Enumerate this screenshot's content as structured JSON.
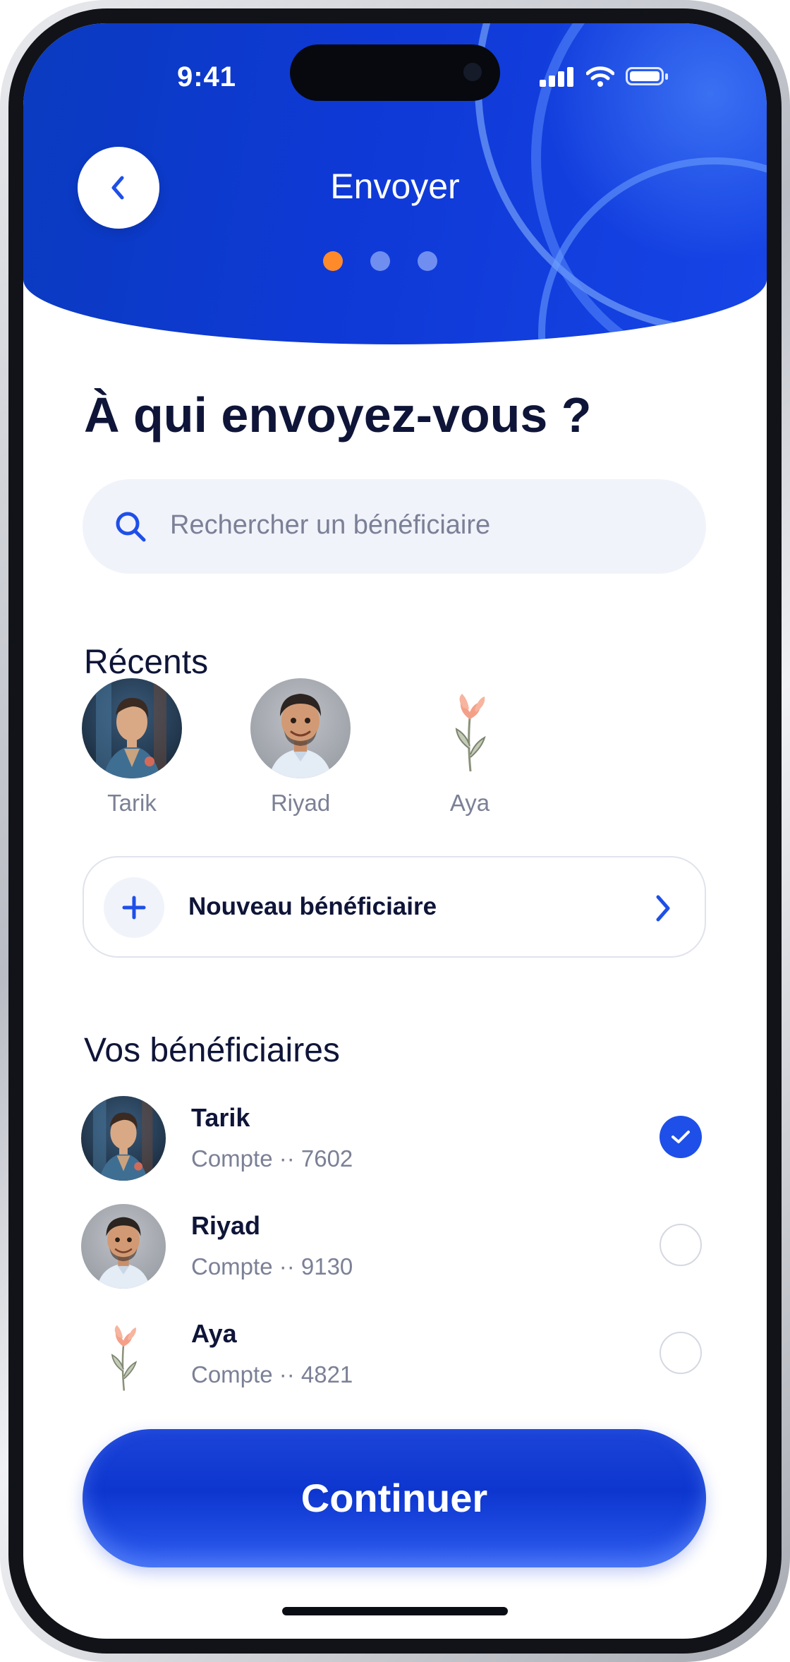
{
  "status_bar": {
    "time": "9:41"
  },
  "header": {
    "title": "Envoyer",
    "steps_total": 3,
    "current_step": 1,
    "colors": {
      "background": "#0f39d6",
      "active_dot": "#ff8a2a",
      "inactive_dot": "#6f8ef0"
    }
  },
  "page": {
    "question": "À qui envoyez-vous ?"
  },
  "search": {
    "placeholder": "Rechercher un bénéficiaire",
    "icon": "search-icon"
  },
  "recents": {
    "title": "Récents",
    "items": [
      {
        "name": "Tarik",
        "avatar": "avatar-tarik"
      },
      {
        "name": "Riyad",
        "avatar": "avatar-riyad"
      },
      {
        "name": "Aya",
        "avatar": "flower-icon"
      }
    ]
  },
  "new_beneficiary": {
    "label": "Nouveau bénéficiaire",
    "icon": "plus-icon"
  },
  "beneficiaries": {
    "title": "Vos bénéficiaires",
    "items": [
      {
        "name": "Tarik",
        "account": "Compte ·· 7602",
        "selected": true
      },
      {
        "name": "Riyad",
        "account": "Compte ·· 9130",
        "selected": false
      },
      {
        "name": "Aya",
        "account": "Compte ·· 4821",
        "selected": false
      }
    ]
  },
  "continue_button": {
    "label": "Continuer",
    "color": "#1c44d8"
  }
}
